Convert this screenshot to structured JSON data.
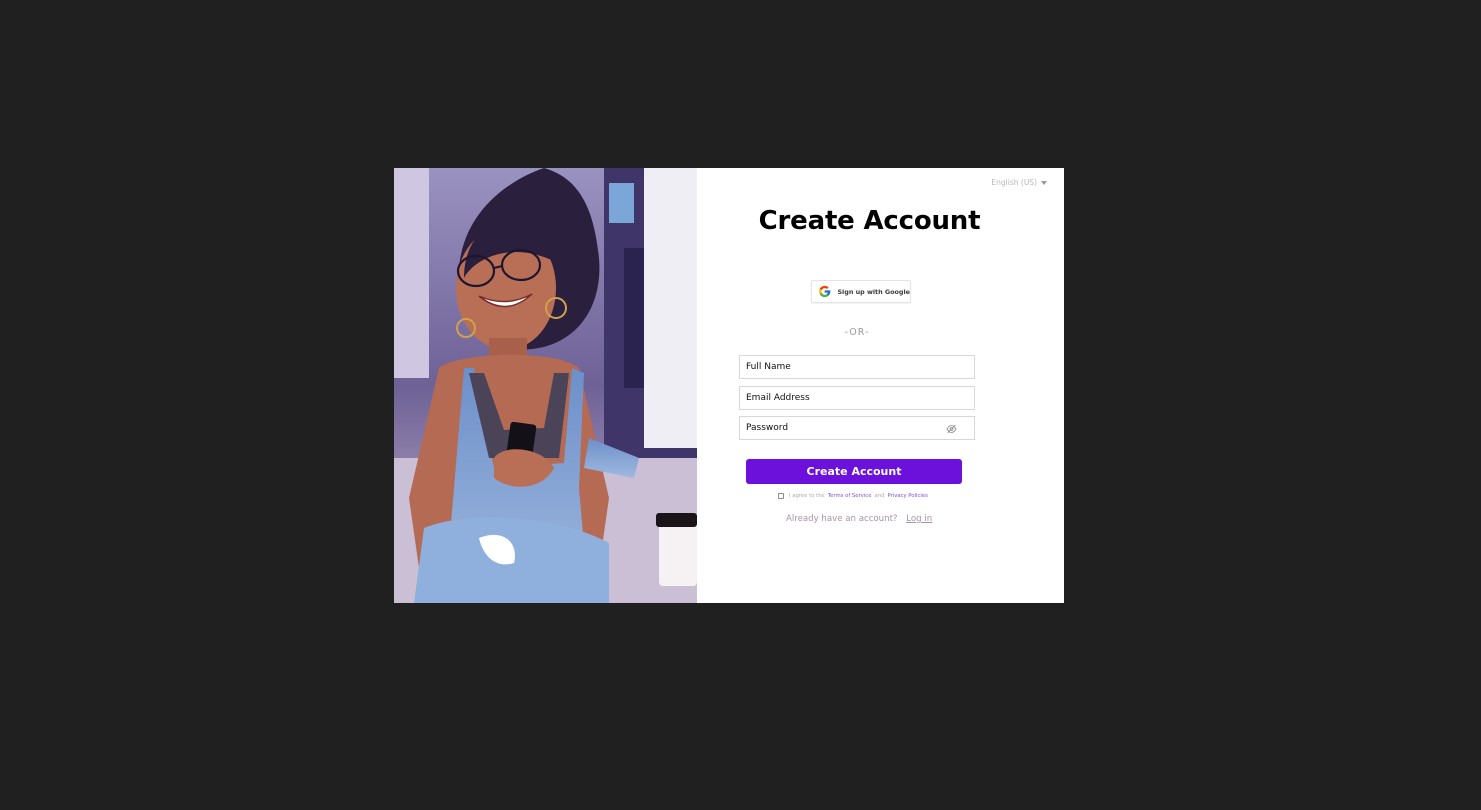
{
  "colors": {
    "backdrop": "#202020",
    "primary_button": "#6c10dc",
    "link": "#7b4fd1"
  },
  "language": {
    "selected": "English (US)"
  },
  "form": {
    "title": "Create Account",
    "google_button_label": "Sign up with Google",
    "divider": "-OR-",
    "full_name_placeholder": "Full Name",
    "email_placeholder": "Email Address",
    "password_placeholder": "Password",
    "submit_label": "Create Account",
    "agree": {
      "prefix": "I agree to the",
      "terms": "Terms of Service",
      "and": "and",
      "privacy": "Privacy Policies"
    },
    "login_prompt": "Already have an account?",
    "login_link": "Log in"
  },
  "icons": {
    "google": "google-g-icon",
    "eye": "eye-off-icon",
    "caret": "chevron-down-icon"
  }
}
